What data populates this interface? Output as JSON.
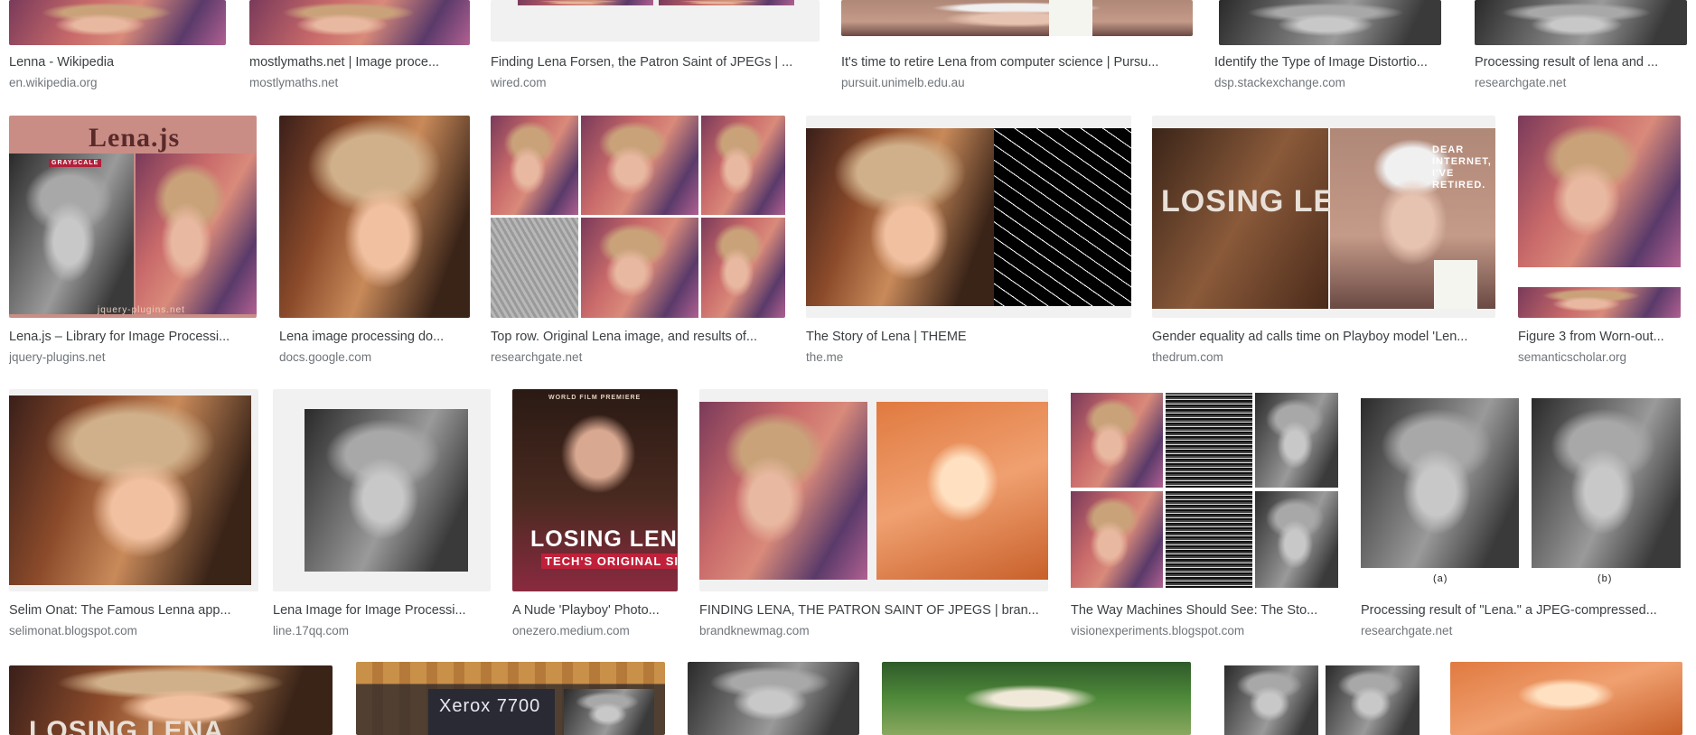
{
  "row1": [
    {
      "title": "Lenna - Wikipedia",
      "source": "en.wikipedia.org"
    },
    {
      "title": "mostlymaths.net | Image proce...",
      "source": "mostlymaths.net"
    },
    {
      "title": "Finding Lena Forsen, the Patron Saint of JPEGs | ...",
      "source": "wired.com"
    },
    {
      "title": "It's time to retire Lena from computer science | Pursu...",
      "source": "pursuit.unimelb.edu.au"
    },
    {
      "title": "Identify the Type of Image Distortio...",
      "source": "dsp.stackexchange.com"
    },
    {
      "title": "Processing result of lena and ...",
      "source": "researchgate.net"
    }
  ],
  "row2": [
    {
      "title": "Lena.js – Library for Image Processi...",
      "source": "jquery-plugins.net",
      "overlay_title": "Lena.js",
      "overlay_badge": "GRAYSCALE",
      "overlay_footer": "jquery-plugins.net"
    },
    {
      "title": "Lena image processing do...",
      "source": "docs.google.com"
    },
    {
      "title": "Top row. Original Lena image, and results of...",
      "source": "researchgate.net"
    },
    {
      "title": "The Story of Lena | THEME",
      "source": "the.me"
    },
    {
      "title": "Gender equality ad calls time on Playboy model 'Len...",
      "source": "thedrum.com",
      "overlay_text": "LOSING LENA",
      "overlay_side": "DEAR INTERNET, I'VE RETIRED."
    },
    {
      "title": "Figure 3 from Worn-out...",
      "source": "semanticscholar.org"
    }
  ],
  "row3": [
    {
      "title": "Selim Onat: The Famous Lenna app...",
      "source": "selimonat.blogspot.com"
    },
    {
      "title": "Lena Image for Image Processi...",
      "source": "line.17qq.com"
    },
    {
      "title": "A Nude 'Playboy' Photo...",
      "source": "onezero.medium.com",
      "overlay_top": "WORLD FILM PREMIERE",
      "overlay_main": "LOSING LENA",
      "overlay_sub": "TECH'S ORIGINAL SIN"
    },
    {
      "title": "FINDING LENA, THE PATRON SAINT OF JPEGS | bran...",
      "source": "brandknewmag.com"
    },
    {
      "title": "The Way Machines Should See: The Sto...",
      "source": "visionexperiments.blogspot.com"
    },
    {
      "title": "Processing result of \"Lena.\" a JPEG-compressed...",
      "source": "researchgate.net",
      "label_a": "(a)",
      "label_b": "(b)"
    }
  ],
  "row4": {
    "losing_text": "LOSING LENA",
    "xerox_text": "Xerox 7700"
  }
}
